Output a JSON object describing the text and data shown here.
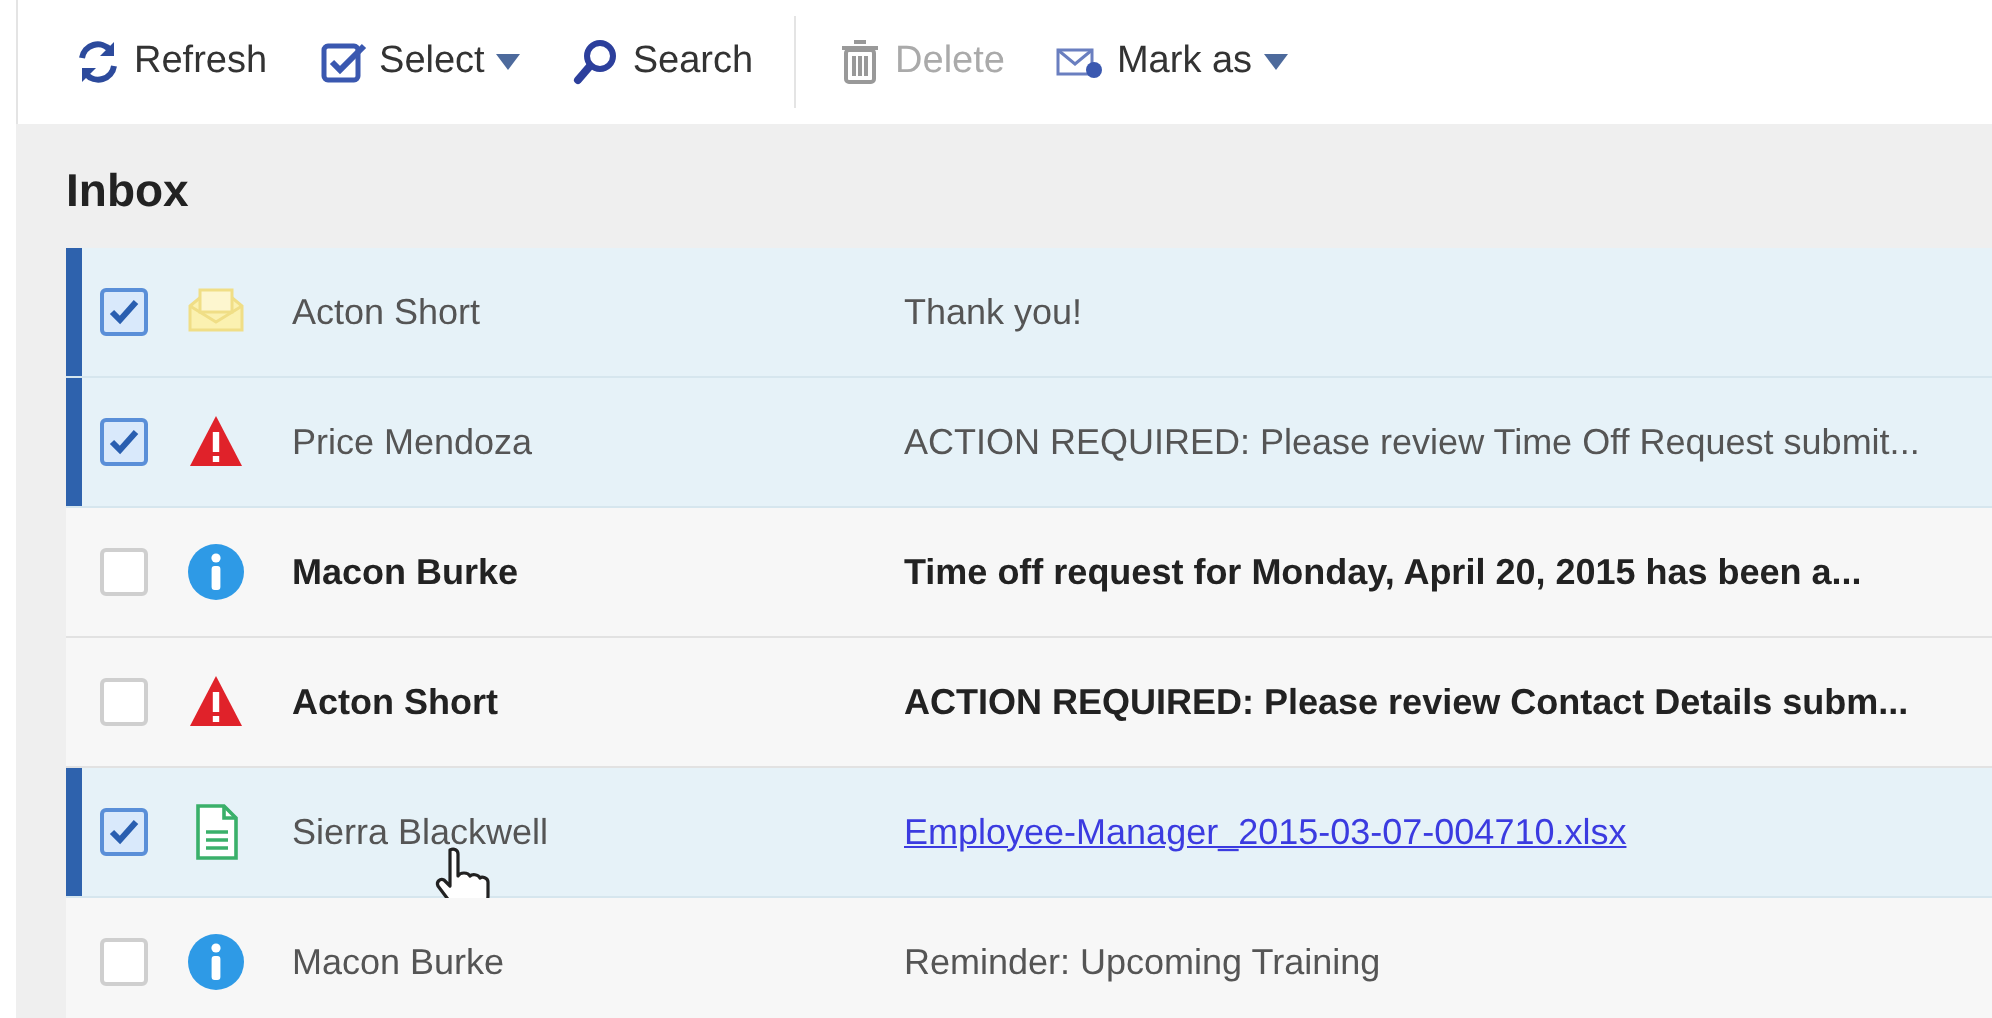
{
  "toolbar": {
    "groups": [
      [
        {
          "label": "Refresh",
          "disabled": false,
          "dropdown": false
        },
        {
          "label": "Select",
          "disabled": false,
          "dropdown": true
        },
        {
          "label": "Search",
          "disabled": false,
          "dropdown": false
        }
      ],
      [
        {
          "label": "Delete",
          "disabled": true,
          "dropdown": false
        },
        {
          "label": "Mark as",
          "disabled": false,
          "dropdown": true
        }
      ]
    ]
  },
  "folder": {
    "title": "Inbox"
  },
  "messages": [
    {
      "kind": "note",
      "selected": true,
      "unread": false,
      "sender": "Acton Short",
      "subject": "Thank you!"
    },
    {
      "kind": "alert",
      "selected": true,
      "unread": false,
      "sender": "Price Mendoza",
      "subject": "ACTION REQUIRED: Please review Time Off Request submit..."
    },
    {
      "kind": "info",
      "selected": false,
      "unread": true,
      "sender": "Macon Burke",
      "subject": "Time off request for Monday, April 20, 2015 has been a..."
    },
    {
      "kind": "alert",
      "selected": false,
      "unread": true,
      "sender": "Acton Short",
      "subject": "ACTION REQUIRED: Please review Contact Details subm..."
    },
    {
      "kind": "file",
      "selected": true,
      "unread": false,
      "sender": "Sierra Blackwell",
      "subject": "Employee-Manager_2015-03-07-004710.xlsx"
    },
    {
      "kind": "info",
      "selected": false,
      "unread": false,
      "sender": "Macon Burke",
      "subject": "Reminder: Upcoming Training"
    }
  ]
}
